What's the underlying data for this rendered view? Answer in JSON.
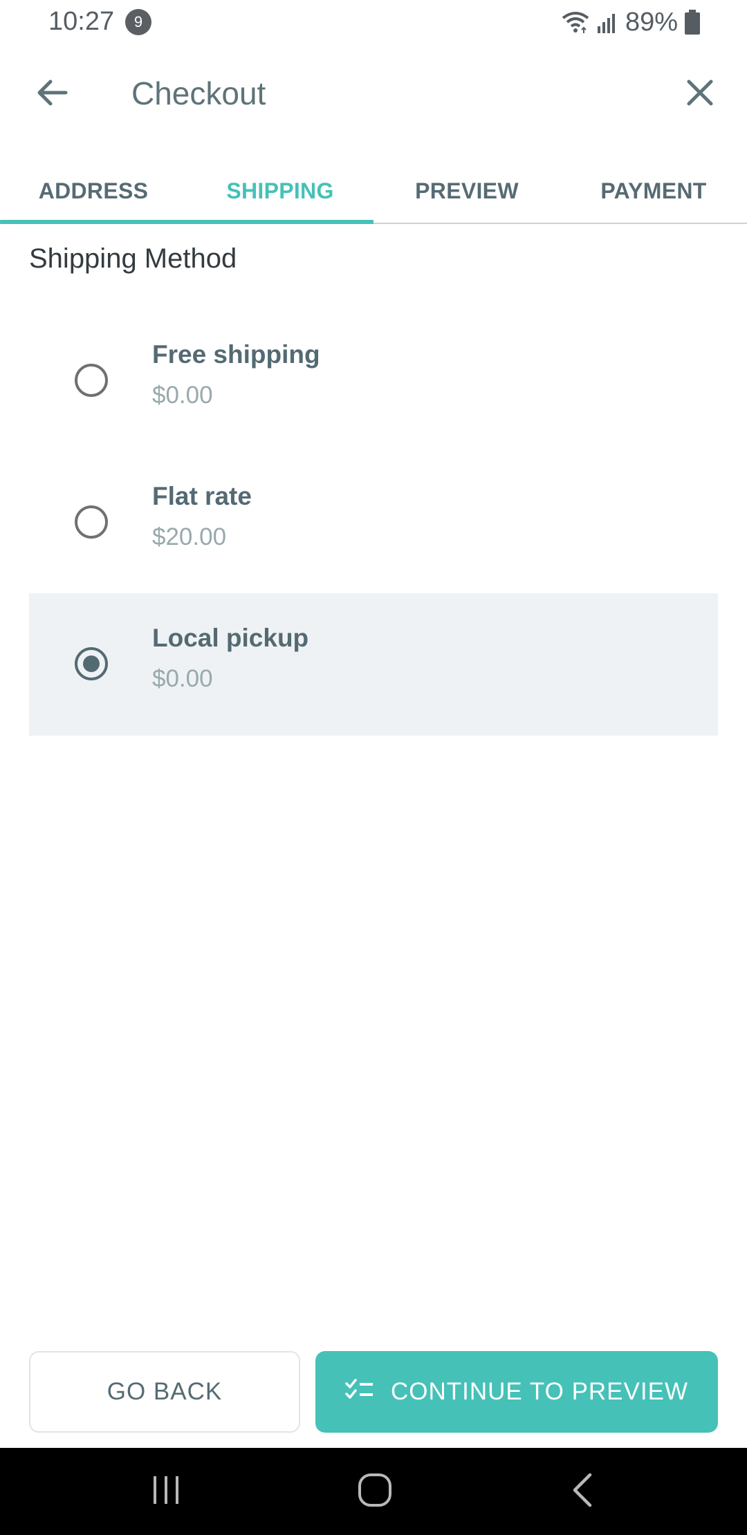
{
  "status_bar": {
    "time": "10:27",
    "notification_count": "9",
    "battery": "89%"
  },
  "app_bar": {
    "title": "Checkout",
    "back_icon": "arrow-left-icon",
    "close_icon": "close-icon"
  },
  "tabs": [
    {
      "label": "ADDRESS",
      "active": false
    },
    {
      "label": "SHIPPING",
      "active": true
    },
    {
      "label": "PREVIEW",
      "active": false
    },
    {
      "label": "PAYMENT",
      "active": false
    }
  ],
  "section_title": "Shipping Method",
  "shipping_options": [
    {
      "name": "Free shipping",
      "price": "$0.00",
      "selected": false
    },
    {
      "name": "Flat rate",
      "price": "$20.00",
      "selected": false
    },
    {
      "name": "Local pickup",
      "price": "$0.00",
      "selected": true
    }
  ],
  "actions": {
    "back_label": "GO BACK",
    "continue_label": "CONTINUE TO PREVIEW",
    "continue_icon": "checklist-icon"
  },
  "colors": {
    "accent": "#45c1b8",
    "text_primary": "#546a73",
    "text_muted": "#98a9ad",
    "selected_bg": "#eff2f4",
    "nav_bar": "#000000"
  }
}
